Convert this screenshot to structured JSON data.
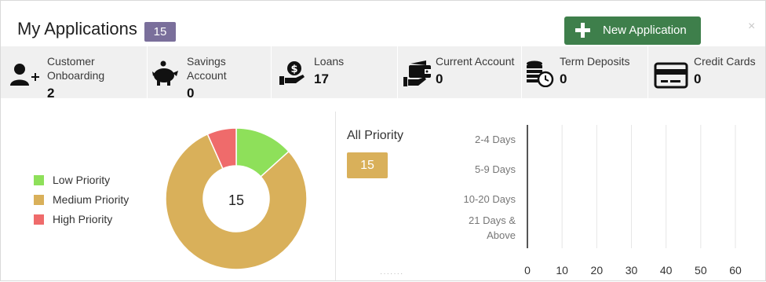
{
  "header": {
    "title": "My Applications",
    "count": "15",
    "new_button_label": "New Application",
    "close_glyph": "×"
  },
  "categories": [
    {
      "label": "Customer\nOnboarding",
      "value": "2",
      "icon": "user-plus-icon"
    },
    {
      "label": "Savings\nAccount",
      "value": "0",
      "icon": "piggy-bank-icon"
    },
    {
      "label": "Loans",
      "value": "17",
      "icon": "hand-coin-icon"
    },
    {
      "label": "Current Account",
      "value": "0",
      "icon": "wallet-icon"
    },
    {
      "label": "Term Deposits",
      "value": "0",
      "icon": "coins-clock-icon"
    },
    {
      "label": "Credit Cards",
      "value": "0",
      "icon": "credit-card-icon"
    }
  ],
  "legend": [
    {
      "label": "Low Priority",
      "color": "#8ee05a"
    },
    {
      "label": "Medium Priority",
      "color": "#d9b05a"
    },
    {
      "label": "High Priority",
      "color": "#ef6b6b"
    }
  ],
  "donut": {
    "center_label": "15",
    "slices": [
      {
        "name": "Low Priority",
        "value": 2,
        "color": "#8ee05a"
      },
      {
        "name": "Medium Priority",
        "value": 12,
        "color": "#d9b05a"
      },
      {
        "name": "High Priority",
        "value": 1,
        "color": "#ef6b6b"
      }
    ]
  },
  "priority_panel": {
    "title": "All Priority",
    "count": "15"
  },
  "chart_data": {
    "type": "bar",
    "orientation": "horizontal",
    "categories": [
      "2-4 Days",
      "5-9 Days",
      "10-20 Days",
      "21 Days & Above"
    ],
    "values": [
      0,
      0,
      0,
      0
    ],
    "xlim": [
      0,
      60
    ],
    "x_ticks": [
      0,
      10,
      20,
      30,
      40,
      50,
      60
    ],
    "grid": true
  }
}
